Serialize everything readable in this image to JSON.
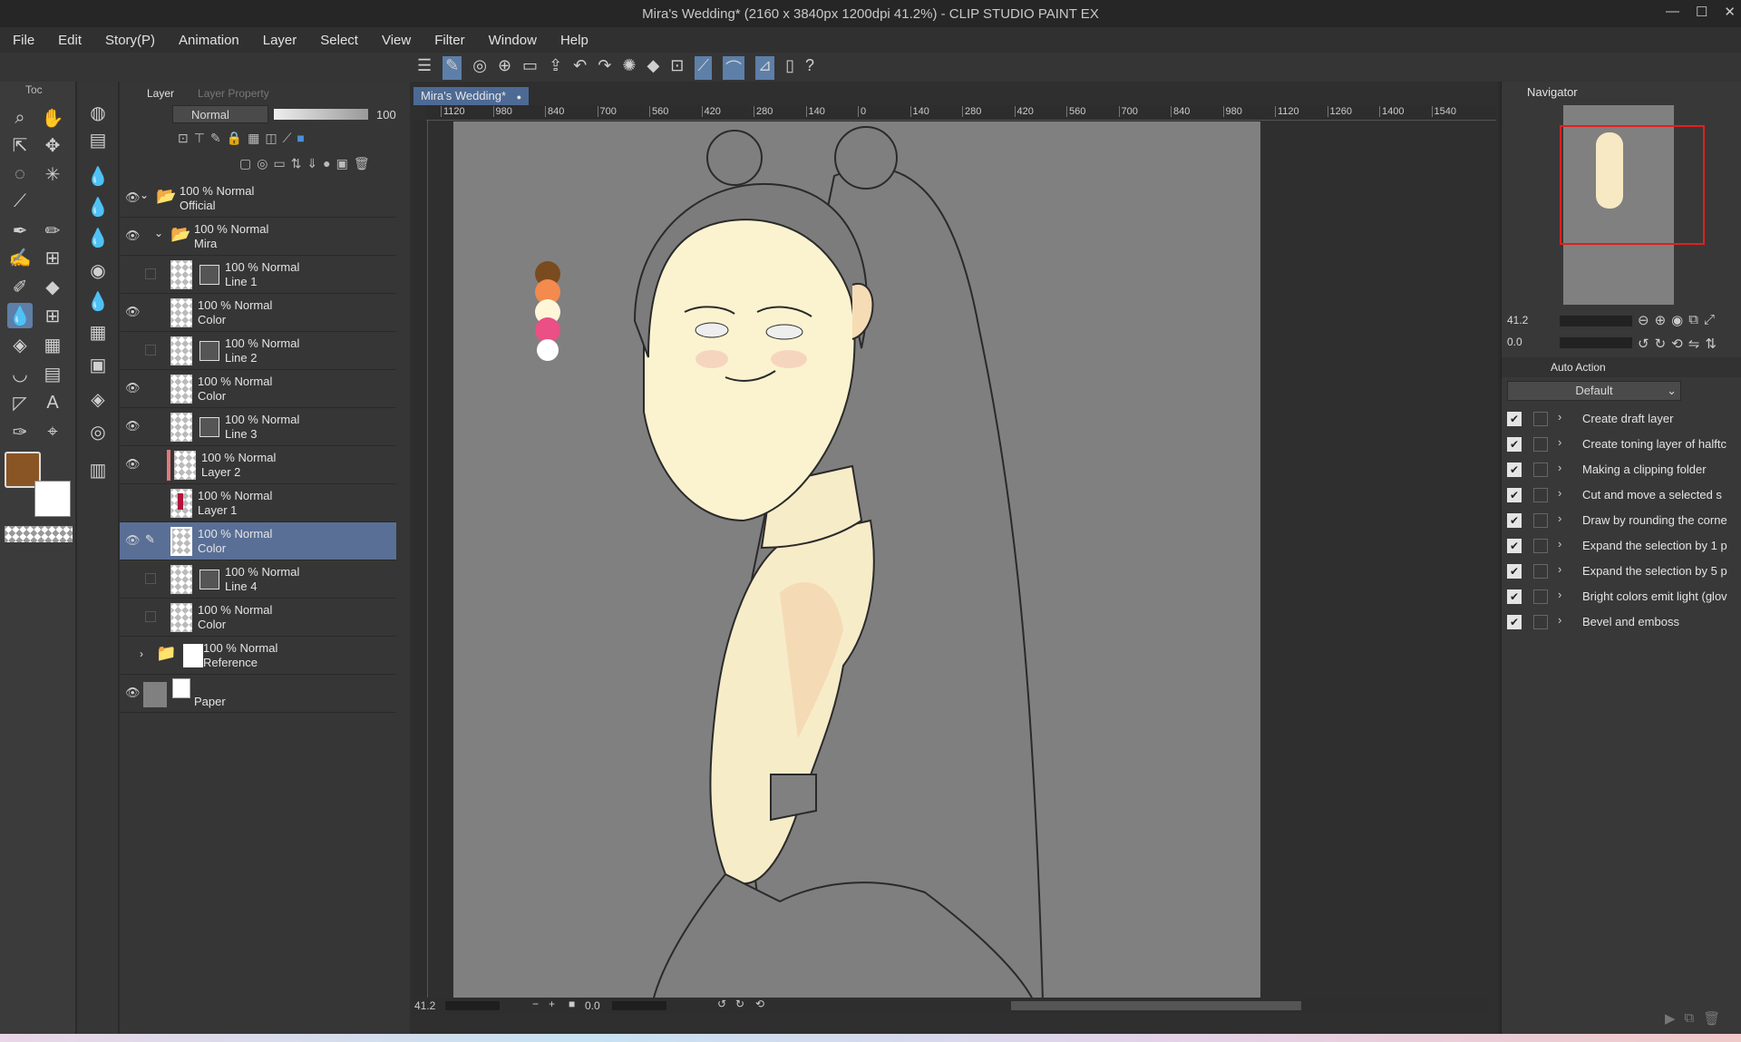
{
  "window": {
    "title": "Mira's Wedding* (2160 x 3840px 1200dpi 41.2%)  - CLIP STUDIO PAINT EX"
  },
  "menu": [
    "File",
    "Edit",
    "Story(P)",
    "Animation",
    "Layer",
    "Select",
    "View",
    "Filter",
    "Window",
    "Help"
  ],
  "tool_panel": {
    "tab_label": "Toc"
  },
  "layer_panel": {
    "tabs": [
      "Layer",
      "Layer Property"
    ],
    "blend_mode": "Normal",
    "opacity": "100",
    "layers": [
      {
        "line1": "100 % Normal",
        "line2": "Official",
        "kind": "folder"
      },
      {
        "line1": "100 % Normal",
        "line2": "Mira",
        "kind": "folder"
      },
      {
        "line1": "100 % Normal",
        "line2": "Line 1",
        "kind": "vector"
      },
      {
        "line1": "100 % Normal",
        "line2": "Color",
        "kind": "raster"
      },
      {
        "line1": "100 % Normal",
        "line2": "Line 2",
        "kind": "vector"
      },
      {
        "line1": "100 % Normal",
        "line2": "Color",
        "kind": "raster"
      },
      {
        "line1": "100 % Normal",
        "line2": "Line 3",
        "kind": "vector"
      },
      {
        "line1": "100 % Normal",
        "line2": "Layer 2",
        "kind": "raster"
      },
      {
        "line1": "100 % Normal",
        "line2": "Layer 1",
        "kind": "raster"
      },
      {
        "line1": "100 % Normal",
        "line2": "Color",
        "kind": "raster"
      },
      {
        "line1": "100 % Normal",
        "line2": "Line 4",
        "kind": "vector"
      },
      {
        "line1": "100 % Normal",
        "line2": "Color",
        "kind": "raster"
      },
      {
        "line1": "100 % Normal",
        "line2": "Reference",
        "kind": "folder"
      },
      {
        "line1": "",
        "line2": "Paper",
        "kind": "paper"
      }
    ]
  },
  "document": {
    "tab": "Mira's Wedding*",
    "ruler_labels": [
      "1120",
      "980",
      "840",
      "700",
      "560",
      "420",
      "280",
      "140",
      "0",
      "140",
      "280",
      "420",
      "560",
      "700",
      "840",
      "980",
      "1120",
      "1260",
      "1400",
      "1540"
    ],
    "zoom": "41.2",
    "rotation": "0.0"
  },
  "navigator": {
    "title": "Navigator",
    "zoom": "41.2",
    "rotation": "0.0"
  },
  "auto_action": {
    "title": "Auto Action",
    "set": "Default",
    "items": [
      "Create draft layer",
      "Create toning layer of halftc",
      "Making a clipping folder",
      "Cut and move a selected s",
      "Draw by rounding the corne",
      "Expand the selection by 1 p",
      "Expand the selection by 5 p",
      "Bright colors emit light (glov",
      "Bevel and emboss"
    ]
  },
  "colors": {
    "main": "#8a5524",
    "sub": "#ffffff",
    "accent": "#5a6f96"
  }
}
